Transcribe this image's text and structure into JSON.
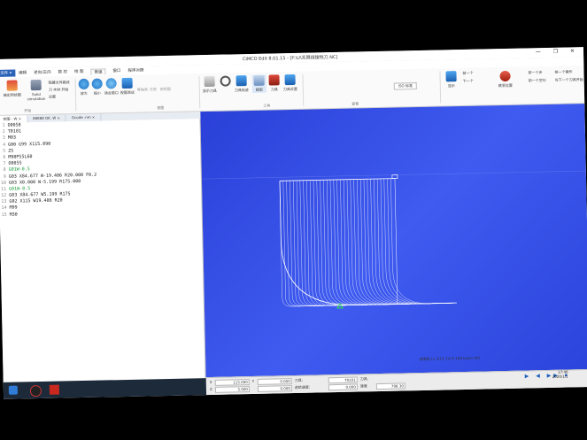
{
  "window": {
    "title": "CIMCO Edit 8.01.15 - [F:\\U\\无限绕镗铣刀.NC]",
    "controls": "—  ❐  ✕"
  },
  "menu": {
    "file": "文件 ▾",
    "items": [
      "编辑",
      "逆向/正向",
      "数 控",
      "绘 图",
      "管道",
      "窗口",
      "程序对照"
    ],
    "active_index": 4
  },
  "ribbon": {
    "backplot_file": "输出到绘图",
    "solid_simulation": "Solid simulation",
    "check_text": "隐藏文件路线",
    "check_tool": "刀 木材 开始",
    "settings": "设置",
    "group1": "开始",
    "group2": "视图",
    "group3": "工具",
    "group4": "查看",
    "zoom_in": "放大",
    "zoom_out": "缩小",
    "fit": "适合窗口",
    "views": "视图测试",
    "small_btns": [
      "等轴测",
      "左视",
      "俯视图"
    ],
    "display_opts": [
      "刀具轨迹",
      "模型",
      "刀具",
      "刀具设置"
    ],
    "disp_label": "显示刀具",
    "iso_label": "ISO 标准",
    "show_label": "显示",
    "prev_next": [
      "前一个",
      "下一个",
      "上一个",
      "至下一个"
    ],
    "goto": "跳至位置",
    "step_labels": [
      "前一个步",
      "前一个空行",
      "前一个操作",
      "与下一个刀具开始"
    ]
  },
  "editor_tabs": [
    "绘图 - W ×",
    "88888 OK .W ×",
    "Gcode .nm ×"
  ],
  "code_lines": [
    {
      "no": "1",
      "text": "O0058",
      "green": false
    },
    {
      "no": "2",
      "text": "T0101",
      "green": false
    },
    {
      "no": "3",
      "text": "M03",
      "green": false
    },
    {
      "no": "4",
      "text": "G00 G99 X115.090",
      "green": false
    },
    {
      "no": "5",
      "text": "Z5",
      "green": false
    },
    {
      "no": "6",
      "text": "M98P55L60",
      "green": false
    },
    {
      "no": "7",
      "text": "O0055",
      "green": false
    },
    {
      "no": "8",
      "text": "G01W-0.5",
      "green": true
    },
    {
      "no": "9",
      "text": "G03 X84.677 W-19.486 R20.000 F0.2",
      "green": false
    },
    {
      "no": "10",
      "text": "G03 X0.000 W-5.199 R175.000",
      "green": false
    },
    {
      "no": "11",
      "text": "G01W-0.5",
      "green": true
    },
    {
      "no": "12",
      "text": "G03 X84.677 W5.199 R175",
      "green": false
    },
    {
      "no": "13",
      "text": "G02 X115 W19.486 R20",
      "green": false
    },
    {
      "no": "14",
      "text": "M99",
      "green": false
    },
    {
      "no": "15",
      "text": "M30",
      "green": false
    }
  ],
  "bottom_panel": {
    "labels": [
      "X",
      "Z",
      "Y",
      "刀具:",
      "进给速度:",
      "刀具:",
      "速度"
    ],
    "values": [
      "115.090",
      "5.000",
      "0.000",
      "0.000",
      "T0101",
      "0.000",
      "798 30"
    ]
  },
  "status": {
    "right_text": "试用版   Ln 3/15  Col 6   188 bytes   INS",
    "clock": "17:40",
    "date": "2020/1/1"
  },
  "colors": {
    "viewport": "#2f48e4",
    "toolpath": "#ffffff",
    "marker": "#33dd55",
    "code_green": "#1a9a3a"
  }
}
